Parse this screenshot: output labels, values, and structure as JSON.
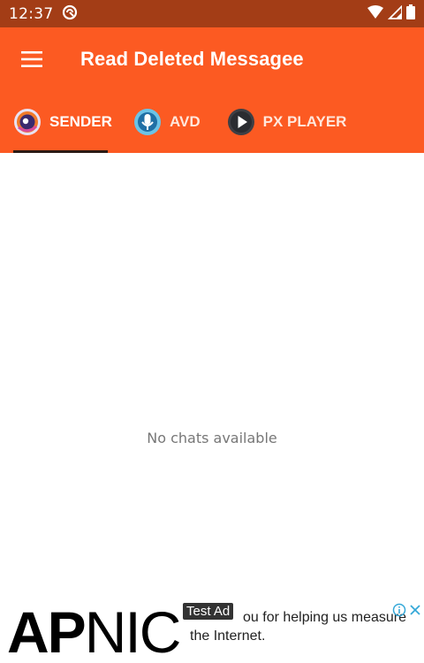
{
  "status_bar": {
    "time": "12:37"
  },
  "app_bar": {
    "title": "Read Deleted Messagee"
  },
  "tabs": [
    {
      "label": "SENDER",
      "icon": "sender-app-icon",
      "selected": true
    },
    {
      "label": "AVD",
      "icon": "avd-app-icon",
      "selected": false
    },
    {
      "label": "PX PLAYER",
      "icon": "play-icon",
      "selected": false
    }
  ],
  "content": {
    "empty_message": "No chats available"
  },
  "ad": {
    "logo_bold": "AP",
    "logo_rest": "NIC",
    "badge": "Test Ad",
    "line1": "ou for helping us measure",
    "line2": "the Internet."
  },
  "colors": {
    "primary": "#fc5a22",
    "status_bar": "#a33d16",
    "indicator": "#2b1a14"
  }
}
